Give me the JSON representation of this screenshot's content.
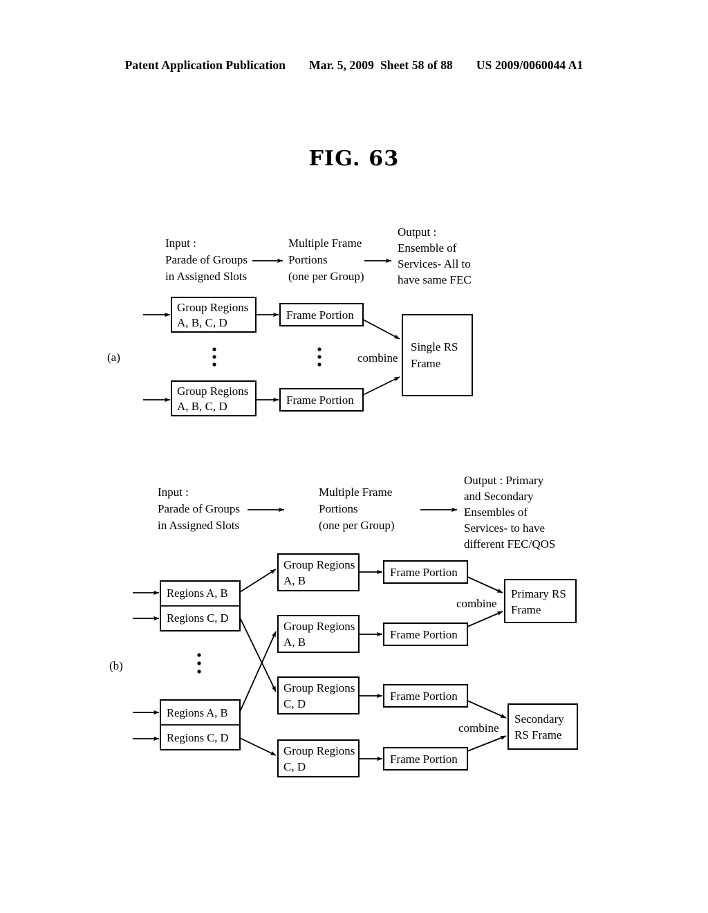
{
  "header": {
    "publication": "Patent Application Publication",
    "date": "Mar. 5, 2009",
    "sheet": "Sheet 58 of 88",
    "patent_number": "US 2009/0060044 A1"
  },
  "figure": {
    "title": "FIG. 63"
  },
  "part_a": {
    "label": "(a)",
    "headings": {
      "input": [
        "Input :",
        "Parade of Groups",
        "in Assigned Slots"
      ],
      "middle": [
        "Multiple Frame",
        "Portions",
        "(one per Group)"
      ],
      "output": [
        "Output :",
        "Ensemble of",
        "Services- All to",
        "have same FEC"
      ]
    },
    "group_boxes": [
      [
        "Group Regions",
        "A, B, C, D"
      ],
      [
        "Group Regions",
        "A, B, C, D"
      ]
    ],
    "frame_portions": [
      "Frame Portion",
      "Frame Portion"
    ],
    "combine_label": "combine",
    "output_box": [
      "Single RS",
      "Frame"
    ]
  },
  "part_b": {
    "label": "(b)",
    "headings": {
      "input": [
        "Input :",
        "Parade of Groups",
        "in Assigned Slots"
      ],
      "middle": [
        "Multiple Frame",
        "Portions",
        "(one per Group)"
      ],
      "output": [
        "Output : Primary",
        "and Secondary",
        "Ensembles of",
        "Services- to have",
        "different FEC/QOS"
      ]
    },
    "region_stacks": [
      [
        "Regions A, B",
        "Regions C, D"
      ],
      [
        "Regions A, B",
        "Regions C, D"
      ]
    ],
    "group_boxes": [
      [
        "Group Regions",
        "A, B"
      ],
      [
        "Group Regions",
        "A, B"
      ],
      [
        "Group Regions",
        "C, D"
      ],
      [
        "Group Regions",
        "C, D"
      ]
    ],
    "frame_portions": [
      "Frame Portion",
      "Frame Portion",
      "Frame Portion",
      "Frame Portion"
    ],
    "combine_labels": [
      "combine",
      "combine"
    ],
    "output_boxes": [
      [
        "Primary RS",
        "Frame"
      ],
      [
        "Secondary",
        "RS Frame"
      ]
    ]
  },
  "colors": {
    "ink": "#000000",
    "paper": "#ffffff"
  }
}
